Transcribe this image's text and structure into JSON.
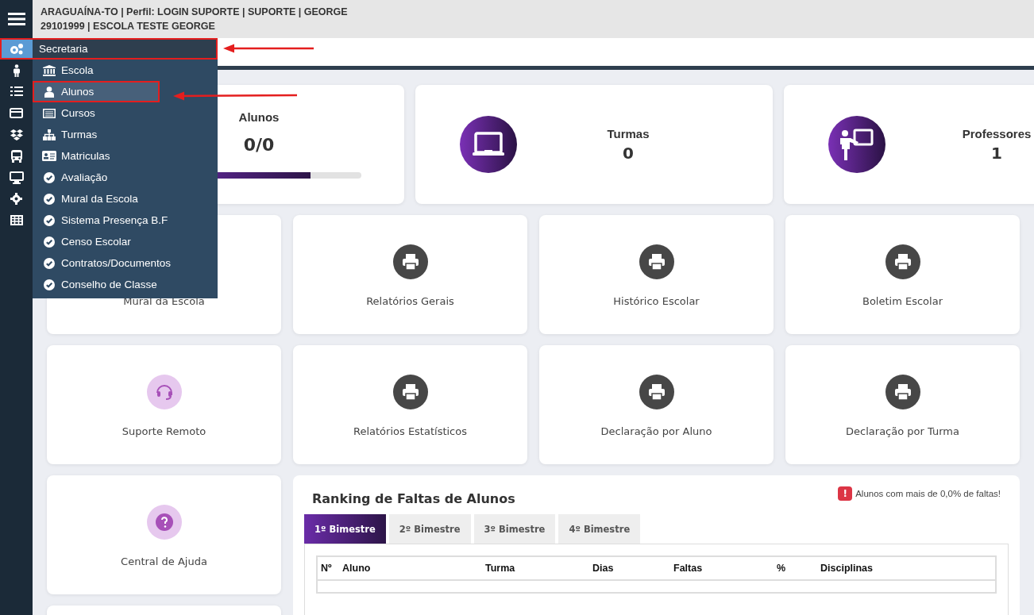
{
  "header": {
    "line_1": "ARAGUAÍNA-TO | Perfil: LOGIN SUPORTE | SUPORTE | GEORGE",
    "line_2": "29101999 | ESCOLA TESTE GEORGE"
  },
  "rail": [
    {
      "kind": "gears",
      "selected": true
    },
    {
      "kind": "person",
      "selected": false
    },
    {
      "kind": "list",
      "selected": false
    },
    {
      "kind": "card",
      "selected": false
    },
    {
      "kind": "boxes",
      "selected": false
    },
    {
      "kind": "bus",
      "selected": false
    },
    {
      "kind": "monitor",
      "selected": false
    },
    {
      "kind": "gear",
      "selected": false
    },
    {
      "kind": "table",
      "selected": false
    }
  ],
  "menu": {
    "title": "Secretaria",
    "items": [
      {
        "label": "Escola",
        "kind": "bank",
        "selected": false
      },
      {
        "label": "Alunos",
        "kind": "user",
        "selected": true
      },
      {
        "label": "Cursos",
        "kind": "list",
        "selected": false
      },
      {
        "label": "Turmas",
        "kind": "sitemap",
        "selected": false
      },
      {
        "label": "Matriculas",
        "kind": "idcard",
        "selected": false
      },
      {
        "label": "Avaliação",
        "kind": "check",
        "selected": false
      },
      {
        "label": "Mural da Escola",
        "kind": "check",
        "selected": false
      },
      {
        "label": "Sistema Presença B.F",
        "kind": "check",
        "selected": false
      },
      {
        "label": "Censo Escolar",
        "kind": "check",
        "selected": false
      },
      {
        "label": "Contratos/Documentos",
        "kind": "check",
        "selected": false
      },
      {
        "label": "Conselho de Classe",
        "kind": "check",
        "selected": false
      }
    ]
  },
  "stats": [
    {
      "kind": "progress",
      "title": "Alunos",
      "value": "0/0",
      "level": 0.75
    },
    {
      "kind": "board",
      "title": "Turmas",
      "value": "0"
    },
    {
      "kind": "teacher",
      "title": "Professores",
      "value": "1"
    }
  ],
  "tiles": [
    {
      "label": "Mural da Escola"
    },
    {
      "label": "Relatórios Gerais",
      "kind": "printer"
    },
    {
      "label": "Histórico Escolar",
      "kind": "printer"
    },
    {
      "label": "Boletim Escolar",
      "kind": "printer"
    },
    {
      "label": "Suporte Remoto",
      "kind": "headset"
    },
    {
      "label": "Relatórios Estatísticos",
      "kind": "printer"
    },
    {
      "label": "Declaração por Aluno",
      "kind": "printer"
    },
    {
      "label": "Declaração por Turma",
      "kind": "printer"
    },
    {
      "label": "Central de Ajuda",
      "kind": "help"
    }
  ],
  "ranking": {
    "title": "Ranking de Faltas de Alunos",
    "alert_icon": "!",
    "alert": "Alunos com mais de 0,0% de faltas!",
    "tabs": [
      {
        "label": "1º Bimestre",
        "selected": true
      },
      {
        "label": "2º Bimestre",
        "selected": false
      },
      {
        "label": "3º Bimestre",
        "selected": false
      },
      {
        "label": "4º Bimestre",
        "selected": false
      }
    ],
    "columns": [
      "Nº",
      "Aluno",
      "Turma",
      "Dias",
      "Faltas",
      "%",
      "Disciplinas"
    ]
  }
}
